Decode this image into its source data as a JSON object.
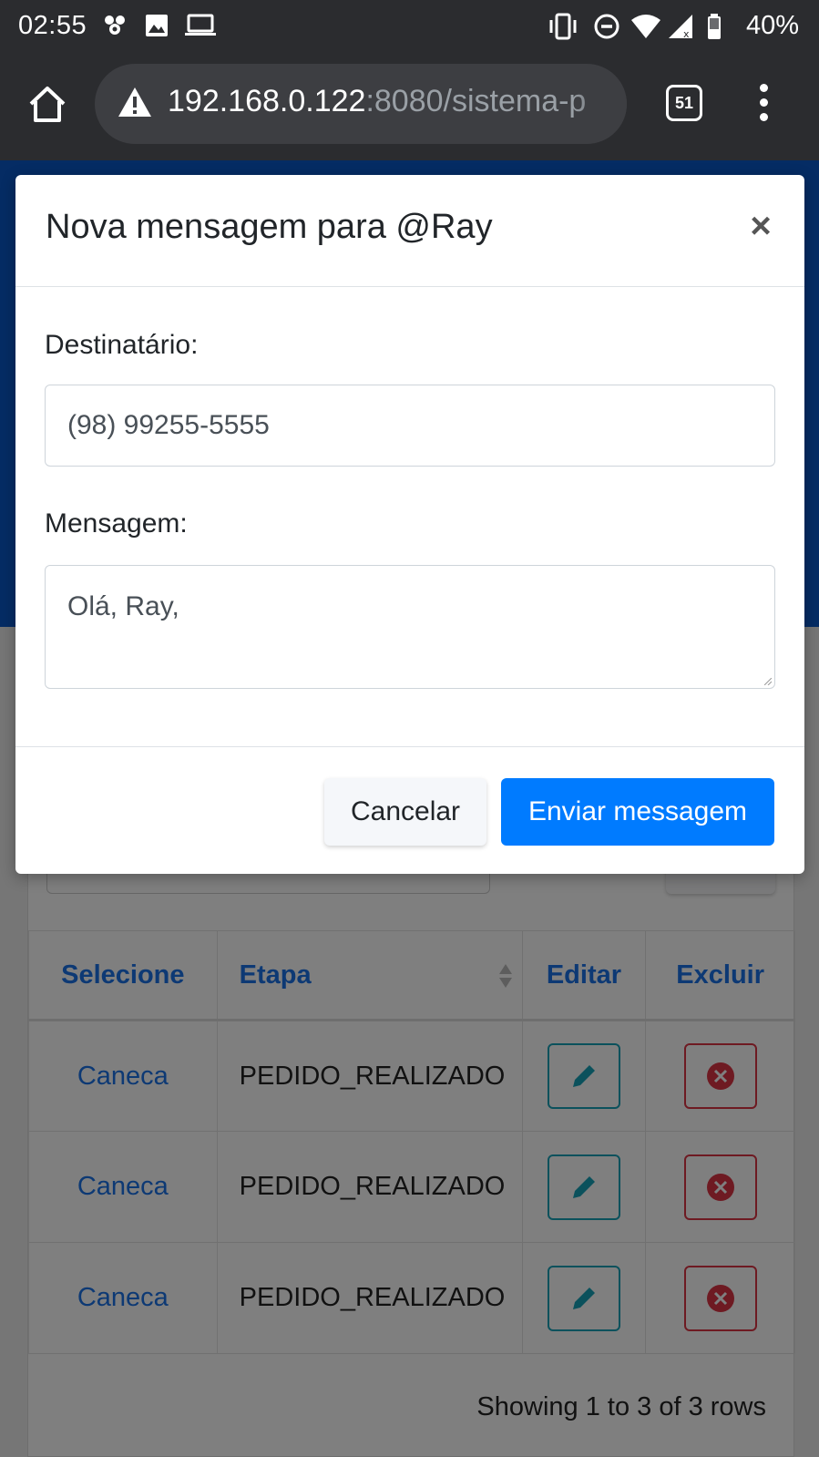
{
  "status_bar": {
    "time": "02:55",
    "battery": "40%"
  },
  "browser": {
    "url_host": "192.168.0.122",
    "url_rest": ":8080/sistema-p",
    "tab_count": "51"
  },
  "table": {
    "headers": [
      "Selecione",
      "Etapa",
      "Editar",
      "Excluir"
    ],
    "rows": [
      {
        "item": "Caneca",
        "etapa": "PEDIDO_REALIZADO"
      },
      {
        "item": "Caneca",
        "etapa": "PEDIDO_REALIZADO"
      },
      {
        "item": "Caneca",
        "etapa": "PEDIDO_REALIZADO"
      }
    ],
    "footer": "Showing 1 to 3 of 3 rows"
  },
  "modal": {
    "title": "Nova mensagem para @Ray",
    "close": "×",
    "recipient_label": "Destinatário:",
    "recipient_value": "(98) 99255-5555",
    "message_label": "Mensagem:",
    "message_value": "Olá, Ray,",
    "cancel_label": "Cancelar",
    "send_label": "Enviar messagem"
  },
  "colors": {
    "primary": "#007bff",
    "link": "#1a73e8",
    "edit": "#17a2b8",
    "delete": "#dc3545",
    "header_blue": "#0a58c9"
  }
}
